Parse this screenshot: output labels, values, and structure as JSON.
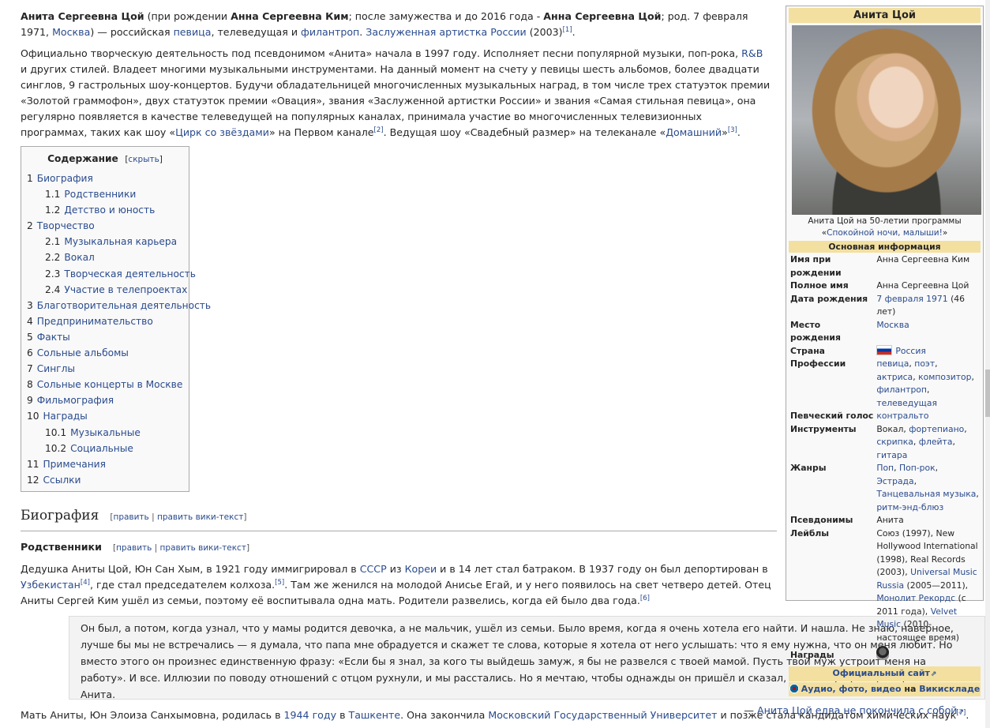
{
  "intro": {
    "name": "Анита Сергеевна Цой",
    "t1": " (при рождении ",
    "birth_name": "Анна Сергеевна Ким",
    "t2": "; после замужества и до 2016 года - ",
    "name2": "Анна Сергеевна Цой",
    "t3": "; род. 7 февраля 1971, ",
    "city": "Москва",
    "t4": ") — российская ",
    "l_singer": "певица",
    "t5": ", телеведущая и ",
    "l_phil": "филантроп",
    "t6": ". ",
    "l_artist": "Заслуженная артистка России",
    "t7": " (2003)",
    "ref1": "[1]",
    "t8": "."
  },
  "career": {
    "t1": "Официально творческую деятельность под псевдонимом «Анита» начала в 1997 году. Исполняет песни популярной музыки, поп-рока, ",
    "l_rnb": "R&B",
    "t2": " и других стилей. Владеет многими музыкальными инструментами. На данный момент на счету у певицы шесть альбомов, более двадцати синглов, 9 гастрольных шоу-концертов. Будучи обладательницей многочисленных музыкальных наград, в том числе трех статуэток премии «Золотой граммофон», двух статуэток премии «Овация», звания «Заслуженной артистки России» и звания «Самая стильная певица», она регулярно появляется в качестве телеведущей на популярных каналах, принимала участие во многочисленных телевизионных программах, таких как шоу «",
    "l_circus": "Цирк со звёздами",
    "t3": "» на Первом канале",
    "ref2": "[2]",
    "t4": ". Ведущая шоу «Свадебный размер» на телеканале «",
    "l_dom": "Домашний",
    "t5": "»",
    "ref3": "[3]",
    "t6": "."
  },
  "toc": {
    "title": "Содержание",
    "hide": "скрыть",
    "items": [
      {
        "num": "1",
        "label": "Биография",
        "sub": false
      },
      {
        "num": "1.1",
        "label": "Родственники",
        "sub": true
      },
      {
        "num": "1.2",
        "label": "Детство и юность",
        "sub": true
      },
      {
        "num": "2",
        "label": "Творчество",
        "sub": false
      },
      {
        "num": "2.1",
        "label": "Музыкальная карьера",
        "sub": true
      },
      {
        "num": "2.2",
        "label": "Вокал",
        "sub": true
      },
      {
        "num": "2.3",
        "label": "Творческая деятельность",
        "sub": true
      },
      {
        "num": "2.4",
        "label": "Участие в телепроектах",
        "sub": true
      },
      {
        "num": "3",
        "label": "Благотворительная деятельность",
        "sub": false
      },
      {
        "num": "4",
        "label": "Предпринимательство",
        "sub": false
      },
      {
        "num": "5",
        "label": "Факты",
        "sub": false
      },
      {
        "num": "6",
        "label": "Сольные альбомы",
        "sub": false
      },
      {
        "num": "7",
        "label": "Синглы",
        "sub": false
      },
      {
        "num": "8",
        "label": "Сольные концерты в Москве",
        "sub": false
      },
      {
        "num": "9",
        "label": "Фильмография",
        "sub": false
      },
      {
        "num": "10",
        "label": "Награды",
        "sub": false
      },
      {
        "num": "10.1",
        "label": "Музыкальные",
        "sub": true
      },
      {
        "num": "10.2",
        "label": "Социальные",
        "sub": true
      },
      {
        "num": "11",
        "label": "Примечания",
        "sub": false
      },
      {
        "num": "12",
        "label": "Ссылки",
        "sub": false
      }
    ]
  },
  "sections": {
    "bio": "Биография",
    "relatives": "Родственники",
    "edit": "править",
    "edit_wiki": "править вики-текст",
    "sep": " | ",
    "lb": "[",
    "rb": "]"
  },
  "relatives_text": {
    "t1": "Дедушка Аниты Цой, Юн Сан Хым, в 1921 году иммигрировал в ",
    "l_ussr": "СССР",
    "t2": " из ",
    "l_korea": "Кореи",
    "t3": " и в 14 лет стал батраком. В 1937 году он был депортирован в ",
    "l_uzb": "Узбекистан",
    "ref4": "[4]",
    "t4": ", где стал председателем колхоза.",
    "ref5": "[5]",
    "t5": ". Там же женился на молодой Анисье Егай, и у него появилось на свет четверо детей. Отец Аниты Сергей Ким ушёл из семьи, поэтому её воспитывала одна мать. Родители развелись, когда ей было два года.",
    "ref6": "[6]"
  },
  "quote": {
    "text": "Он был, а потом, когда узнал, что у мамы родится девочка, а не мальчик, ушёл из семьи. Было время, когда я очень хотела его найти. И нашла. Не знаю, наверное, лучше бы мы не встречались — я думала, что папа мне обрадуется и скажет те слова, которые я хотела от него услышать: что я ему нужна, что он меня любит. Но вместо этого он произнес единственную фразу: «Если бы я знал, за кого ты выйдешь замуж, я бы не развелся с твоей мамой. Пусть твой муж устроит меня на работу». И все. Иллюзии по поводу отношений с отцом рухнули, и мы расстались. Но я мечтаю, чтобы однажды он пришёл и сказал, что я ему нужна, — призналась Анита.",
    "dash": "— ",
    "source": "Анита Цой едва не покончила с собой"
  },
  "mother": {
    "t1": "Мать Аниты, Юн Элоиза Санхымовна, родилась в ",
    "l_year": "1944 году",
    "t2": " в ",
    "l_tash": "Ташкенте",
    "t3": ". Она закончила ",
    "l_msu": "Московский Государственный Университет",
    "t4": " и позже стала кандидатом химических наук",
    "ref7": "[7]",
    "t5": "."
  },
  "infobox": {
    "title": "Анита Цой",
    "caption_t": "Анита Цой на 50-летии программы «",
    "caption_l": "Спокойной ночи, малыши!",
    "caption_e": "»",
    "section": "Основная информация",
    "rows": {
      "birthname_k": "Имя при рождении",
      "birthname_v": "Анна Сергеевна Ким",
      "fullname_k": "Полное имя",
      "fullname_v": "Анна Сергеевна Цой",
      "dob_k": "Дата рождения",
      "dob_l": "7 февраля 1971",
      "dob_t": " (46 лет)",
      "pob_k": "Место рождения",
      "pob_l": "Москва",
      "country_k": "Страна",
      "country_l": "Россия",
      "prof_k": "Профессии",
      "prof_l1": "певица",
      "prof_l2": "поэт",
      "prof_l3": "актриса",
      "prof_l4": "композитор",
      "prof_l5": "филантроп",
      "prof_l6": "телеведущая",
      "voice_k": "Певческий голос",
      "voice_l": "контральто",
      "instr_k": "Инструменты",
      "instr_t": "Вокал, ",
      "instr_l1": "фортепиано",
      "instr_l2": "скрипка",
      "instr_l3": "флейта",
      "instr_l4": "гитара",
      "genres_k": "Жанры",
      "genre_l1": "Поп",
      "genre_l2": "Поп-рок",
      "genre_l3": "Эстрада",
      "genre_l4": "Танцевальная музыка",
      "genre_l5": "ритм-энд-блюз",
      "alias_k": "Псевдонимы",
      "alias_v": "Анита",
      "labels_k": "Лейблы",
      "labels_t1": "Союз (1997), New Hollywood International (1998), Real Records (2003), ",
      "labels_l1": "Universal Music Russia",
      "labels_t2": " (2005—2011), ",
      "labels_l2": "Монолит Рекордс",
      "labels_t3": " (с 2011 года), ",
      "labels_l3": "Velvet Music",
      "labels_t4": " (2010-настоящее время)",
      "awards_k": "Награды"
    },
    "official": "Официальный сайт",
    "commons_l": "Аудио, фото, видео",
    "commons_t": " на ",
    "commons_site": "Викискладе"
  },
  "comma": ", "
}
